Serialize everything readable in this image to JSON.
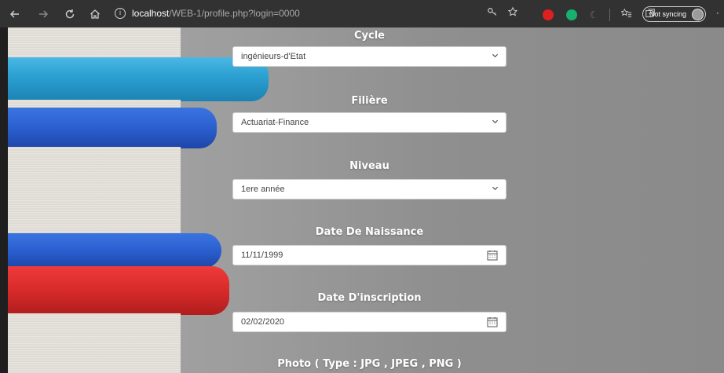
{
  "browser": {
    "url_host": "localhost",
    "url_path": "/WEB-1/profile.php?login=0000",
    "sync_label": "Not syncing"
  },
  "form": {
    "cycle": {
      "label": "Cycle",
      "value": "ingénieurs-d'Etat"
    },
    "filiere": {
      "label": "Filière",
      "value": "Actuariat-Finance"
    },
    "niveau": {
      "label": "Niveau",
      "value": "1ere année"
    },
    "date_naissance": {
      "label": "Date De Naissance",
      "value": "11/11/1999"
    },
    "date_inscription": {
      "label": "Date D'inscription",
      "value": "02/02/2020"
    },
    "photo": {
      "label": "Photo ( Type : JPG , JPEG , PNG )"
    }
  },
  "colors": {
    "toolbar_bg": "#323232",
    "cover_cyan": "#2a9fd0",
    "cover_blue": "#2b5fcf",
    "cover_red": "#d82a2a"
  }
}
